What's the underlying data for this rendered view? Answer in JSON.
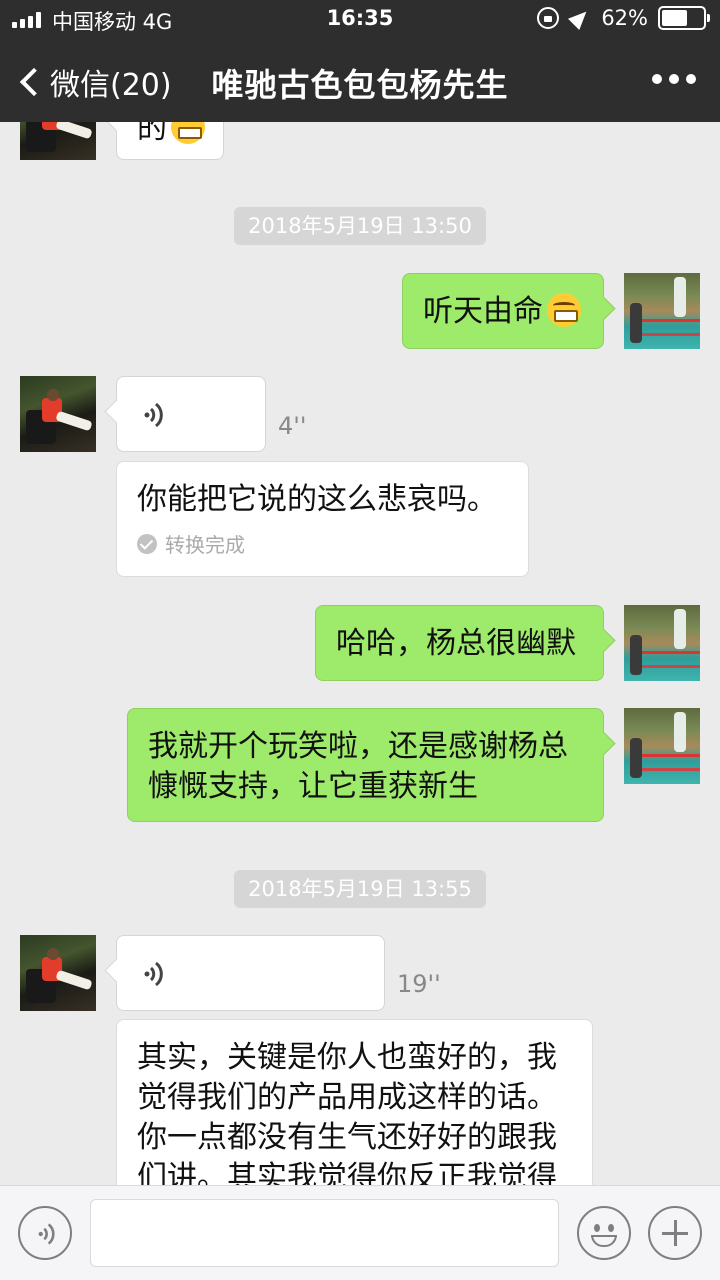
{
  "status_bar": {
    "carrier": "中国移动  4G",
    "time": "16:35",
    "battery_text": "62%",
    "battery_level": 0.62,
    "icons": [
      "signal-icon",
      "rotation-lock-icon",
      "location-icon",
      "battery-icon"
    ]
  },
  "nav": {
    "back_label": "微信(20)",
    "title": "唯驰古色包包杨先生",
    "more_icon": "more-icon"
  },
  "chat": {
    "top_partial_text": "的",
    "timestamps": [
      "2018年5月19日 13:50",
      "2018年5月19日 13:55"
    ],
    "messages": [
      {
        "from": "me",
        "type": "text",
        "text": "听天由命",
        "emoji": "laughing-tears"
      },
      {
        "from": "them",
        "type": "voice",
        "duration": "4''",
        "transcript": "你能把它说的这么悲哀吗。",
        "transcript_status": "转换完成"
      },
      {
        "from": "me",
        "type": "text",
        "text": "哈哈，杨总很幽默"
      },
      {
        "from": "me",
        "type": "text",
        "lines": [
          "我就开个玩笑啦，还是感谢杨总",
          "慷慨支持，让它重获新生"
        ]
      },
      {
        "from": "them",
        "type": "voice",
        "duration": "19''",
        "transcript_lines": [
          "其实，关键是你人也蛮好的，我",
          "觉得我们的产品用成这样的话。",
          "你一点都没有生气还好好的跟我",
          "们讲。其实我觉得你反正我觉得"
        ]
      }
    ]
  },
  "input_bar": {
    "voice_icon": "voice-input-icon",
    "emoji_icon": "emoji-icon",
    "plus_icon": "plus-icon"
  }
}
